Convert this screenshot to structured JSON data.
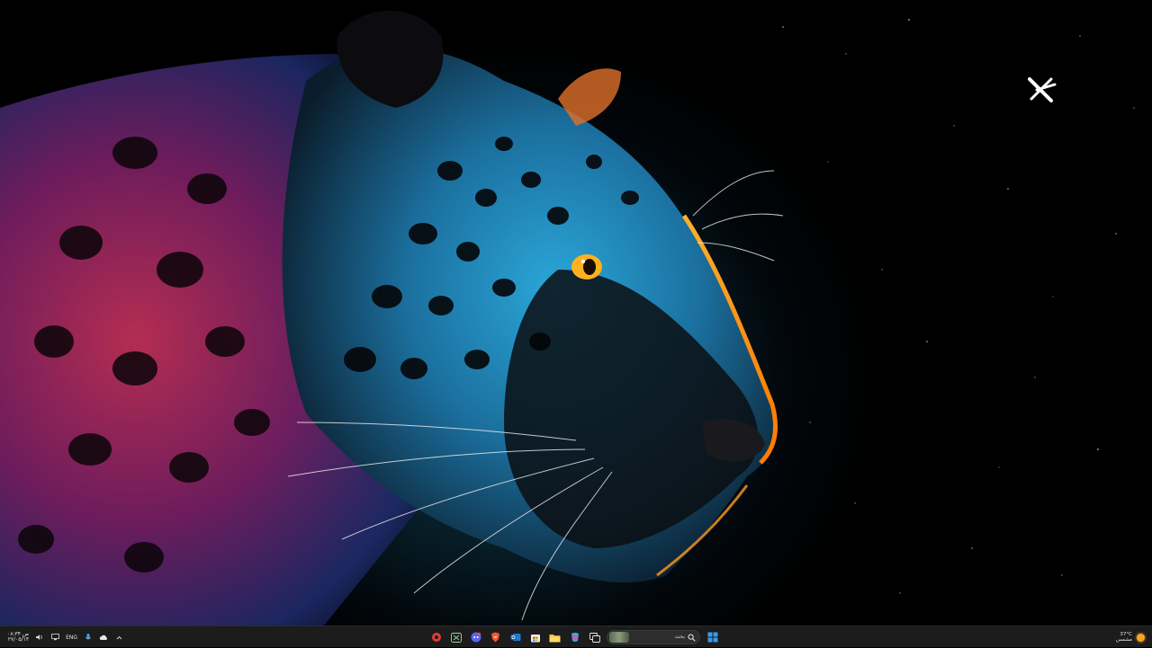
{
  "desktop": {
    "wallpaper": "neon-jaguar-wallpaper",
    "logo_icon": "cross-x-logo-icon"
  },
  "taskbar": {
    "clock": {
      "time": "۰۸:۳۴ ص",
      "date": "۲۷/۰۵/۱۴"
    },
    "language": "ENG",
    "search": {
      "placeholder": "بحث"
    },
    "apps": [
      "game-icon",
      "xbox-icon",
      "discord-icon",
      "brave-icon",
      "outlook-icon",
      "store-icon",
      "file-explorer-icon",
      "copilot-icon",
      "task-view-icon"
    ],
    "weather": {
      "temperature": "37°C",
      "condition": "مشمس"
    },
    "colors": {
      "bar": "#1c1c1c",
      "accent": "#2b8fe8",
      "sun": "#f6a623"
    }
  }
}
